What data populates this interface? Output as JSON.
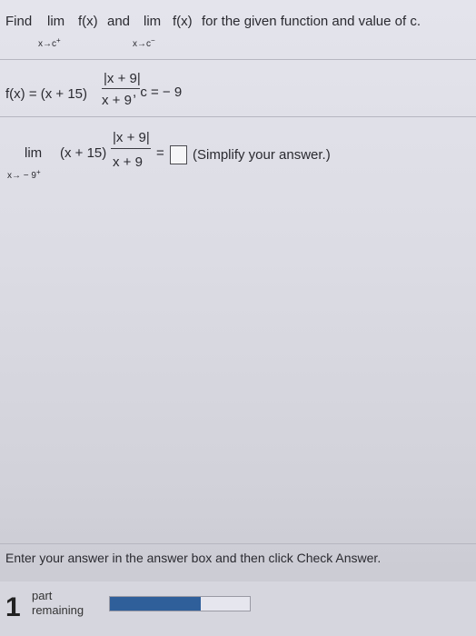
{
  "question": {
    "find": "Find",
    "lim": "lim",
    "fx": "f(x)",
    "and": "and",
    "rest": "for the given function and value of c.",
    "sub_right": "x→c",
    "sub_right_sup": "+",
    "sub_left": "x→c",
    "sub_left_sup": "−"
  },
  "function": {
    "lhs": "f(x) = (x + 15)",
    "numerator": "|x + 9|",
    "denominator": "x + 9",
    "c_value": ", c = − 9"
  },
  "problem": {
    "lim": "lim",
    "sub": "x→ − 9",
    "sub_sup": "+",
    "factor": "(x + 15)",
    "numerator": "|x + 9|",
    "denominator": "x + 9",
    "equals": "=",
    "hint": "(Simplify your answer.)"
  },
  "instruction": "Enter your answer in the answer box and then click Check Answer.",
  "footer": {
    "parts_count": "1",
    "part_line1": "part",
    "part_line2": "remaining",
    "progress_fraction": 0.65
  },
  "colors": {
    "progress_fill": "#2f5f9a",
    "background": "#dcdce4"
  }
}
